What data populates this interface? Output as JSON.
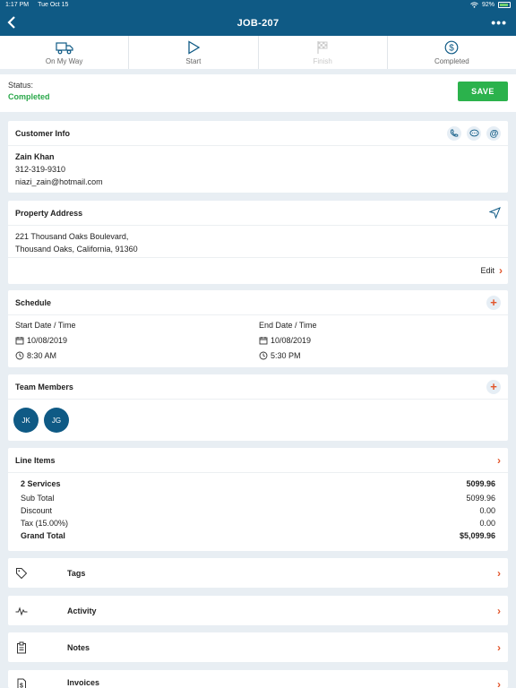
{
  "status_bar": {
    "time": "1:17 PM",
    "date": "Tue Oct 15",
    "battery": "92%"
  },
  "nav": {
    "title": "JOB-207",
    "more_label": "•••"
  },
  "steps": [
    {
      "label": "On My Way",
      "icon": "truck-icon",
      "enabled": true
    },
    {
      "label": "Start",
      "icon": "play-icon",
      "enabled": true
    },
    {
      "label": "Finish",
      "icon": "flag-icon",
      "enabled": false
    },
    {
      "label": "Completed",
      "icon": "dollar-icon",
      "enabled": true
    }
  ],
  "job_status": {
    "label": "Status:",
    "value": "Completed",
    "save_label": "SAVE"
  },
  "customer": {
    "heading": "Customer Info",
    "name": "Zain Khan",
    "phone": "312-319-9310",
    "email": "niazi_zain@hotmail.com"
  },
  "property": {
    "heading": "Property Address",
    "line1": "221 Thousand Oaks Boulevard,",
    "line2": "Thousand Oaks, California, 91360",
    "edit_label": "Edit"
  },
  "schedule": {
    "heading": "Schedule",
    "add_label": "+",
    "start_label": "Start Date / Time",
    "start_date": "10/08/2019",
    "start_time": "8:30 AM",
    "end_label": "End Date / Time",
    "end_date": "10/08/2019",
    "end_time": "5:30 PM"
  },
  "team": {
    "heading": "Team Members",
    "add_label": "+",
    "members": [
      "JK",
      "JG"
    ]
  },
  "line_items": {
    "heading": "Line Items",
    "services_label": "2 Services",
    "services_value": "5099.96",
    "subtotal_label": "Sub Total",
    "subtotal_value": "5099.96",
    "discount_label": "Discount",
    "discount_value": "0.00",
    "tax_label": "Tax (15.00%)",
    "tax_value": "0.00",
    "grand_label": "Grand Total",
    "grand_value": "$5,099.96"
  },
  "sections": [
    {
      "label": "Tags",
      "icon": "tag-icon"
    },
    {
      "label": "Activity",
      "icon": "activity-icon"
    },
    {
      "label": "Notes",
      "icon": "clipboard-icon"
    },
    {
      "label": "Invoices",
      "icon": "invoice-icon"
    }
  ],
  "colors": {
    "brand": "#0f5a85",
    "accent": "#e2562c",
    "success": "#2bb24c"
  }
}
